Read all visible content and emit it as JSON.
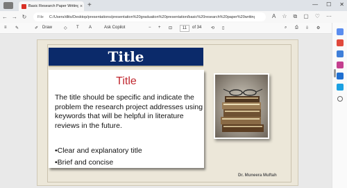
{
  "window": {
    "tab_title": "Basic Research Paper Writing Sk",
    "tab_close": "×",
    "new_tab": "+",
    "minimize": "—",
    "maximize": "☐",
    "close": "✕"
  },
  "addressbar": {
    "back": "←",
    "forward": "→",
    "refresh": "↻",
    "url_label": "File",
    "url": "C:/Users/dlits/Desktop/presentations/presentation%20graduation%20presentation/basic%20research%20paper%20writing%20skills..."
  },
  "pdf_toolbar": {
    "draw_label": "Draw",
    "ask_copilot_label": "Ask Copilot",
    "zoom_out": "−",
    "zoom_in": "+",
    "page_current": "11",
    "page_total": "of 34"
  },
  "slide": {
    "banner_title": "Title",
    "heading": "Title",
    "paragraph": "The title should be specific and indicate the problem the research project addresses using keywords that will be helpful in literature reviews in the future.",
    "bullets": [
      "•Clear and explanatory title",
      "•Brief and concise"
    ],
    "author": "Dr. Muneera Muftah"
  },
  "colors": {
    "banner_bg": "#0b2a6a",
    "heading": "#c0262d",
    "slide_bg": "#ece7d9"
  },
  "icons": [
    "search-icon",
    "settings-icon",
    "favorites-icon",
    "tools-icon",
    "outlook-icon",
    "office-icon",
    "add-icon"
  ]
}
